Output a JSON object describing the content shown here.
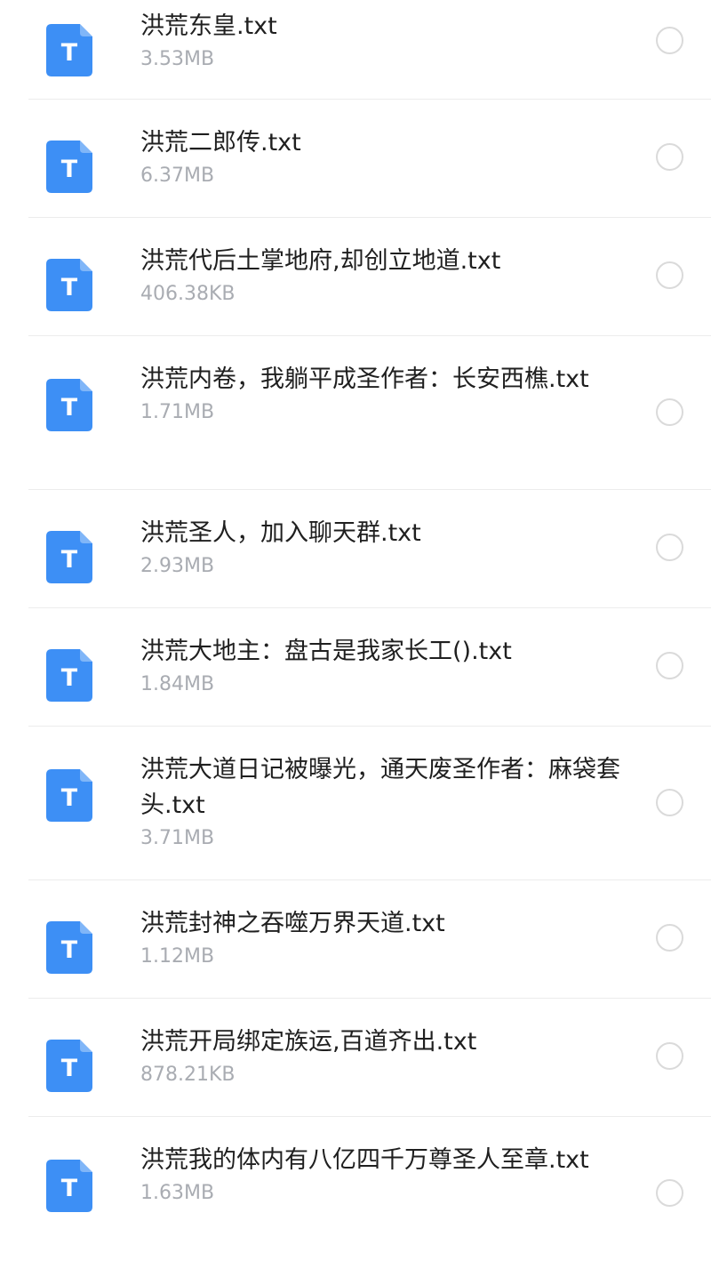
{
  "icon_name": "txt-file-icon",
  "icon_letter": "T",
  "icon_color": "#3d8ff5",
  "accent_text_color": "#1f1f1f",
  "size_text_color": "#a9acb2",
  "files": [
    {
      "name": "洪荒东皇.txt",
      "size": "3.53MB",
      "selected": false
    },
    {
      "name": "洪荒二郎传.txt",
      "size": "6.37MB",
      "selected": false
    },
    {
      "name": "洪荒代后土掌地府,却创立地道.txt",
      "size": "406.38KB",
      "selected": false
    },
    {
      "name": "洪荒内卷，我躺平成圣作者：长安西樵.txt",
      "size": "1.71MB",
      "selected": false
    },
    {
      "name": "洪荒圣人，加入聊天群.txt",
      "size": "2.93MB",
      "selected": false
    },
    {
      "name": "洪荒大地主：盘古是我家长工().txt",
      "size": "1.84MB",
      "selected": false
    },
    {
      "name": "洪荒大道日记被曝光，通天废圣作者：麻袋套头.txt",
      "size": "3.71MB",
      "selected": false
    },
    {
      "name": "洪荒封神之吞噬万界天道.txt",
      "size": "1.12MB",
      "selected": false
    },
    {
      "name": "洪荒开局绑定族运,百道齐出.txt",
      "size": "878.21KB",
      "selected": false
    },
    {
      "name": "洪荒我的体内有八亿四千万尊圣人至章.txt",
      "size": "1.63MB",
      "selected": false
    }
  ]
}
